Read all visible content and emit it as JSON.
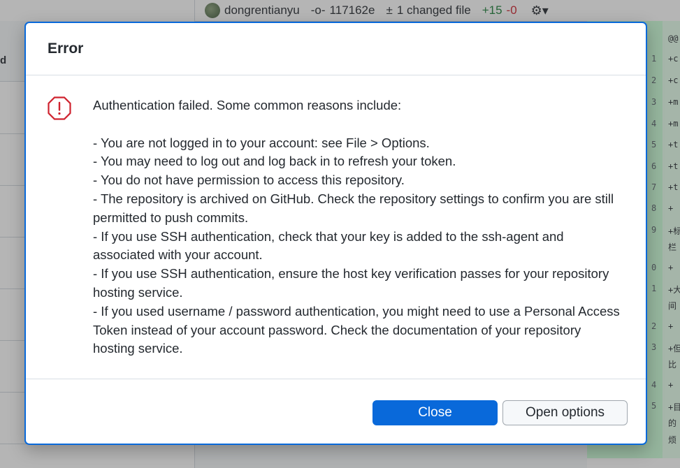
{
  "background": {
    "left_header_fragment": "d",
    "author": "dongrentianyu",
    "commit_sha": "117162e",
    "changed_files": "1 changed file",
    "additions": "+15",
    "deletions": "-0",
    "diff_header": "@@",
    "diff_lines": [
      {
        "num": "1",
        "text": "+c"
      },
      {
        "num": "2",
        "text": "+c"
      },
      {
        "num": "3",
        "text": "+m"
      },
      {
        "num": "4",
        "text": "+m"
      },
      {
        "num": "5",
        "text": "+t"
      },
      {
        "num": "6",
        "text": "+t"
      },
      {
        "num": "7",
        "text": "+t"
      },
      {
        "num": "8",
        "text": "+"
      },
      {
        "num": "9",
        "text": "+标"
      },
      {
        "num": "",
        "text": "栏"
      },
      {
        "num": "0",
        "text": "+"
      },
      {
        "num": "1",
        "text": "+大"
      },
      {
        "num": "",
        "text": "间"
      },
      {
        "num": "2",
        "text": "+"
      },
      {
        "num": "3",
        "text": "+但"
      },
      {
        "num": "",
        "text": "比"
      },
      {
        "num": "4",
        "text": "+"
      },
      {
        "num": "5",
        "text": "+目"
      },
      {
        "num": "",
        "text": "的"
      },
      {
        "num": "",
        "text": "烦"
      }
    ]
  },
  "dialog": {
    "title": "Error",
    "intro": "Authentication failed. Some common reasons include:",
    "reasons": [
      "- You are not logged in to your account: see File > Options.",
      "- You may need to log out and log back in to refresh your token.",
      "- You do not have permission to access this repository.",
      "- The repository is archived on GitHub. Check the repository settings to confirm you are still permitted to push commits.",
      "- If you use SSH authentication, check that your key is added to the ssh-agent and associated with your account.",
      "- If you use SSH authentication, ensure the host key verification passes for your repository hosting service.",
      "- If you used username / password authentication, you might need to use a Personal Access Token instead of your account password. Check the documentation of your repository hosting service."
    ],
    "buttons": {
      "close": "Close",
      "open_options": "Open options"
    },
    "icon": "error-octagon-icon"
  },
  "colors": {
    "accent": "#0969da",
    "error": "#cf222e",
    "added": "#1a7f37",
    "removed": "#cf222e"
  }
}
